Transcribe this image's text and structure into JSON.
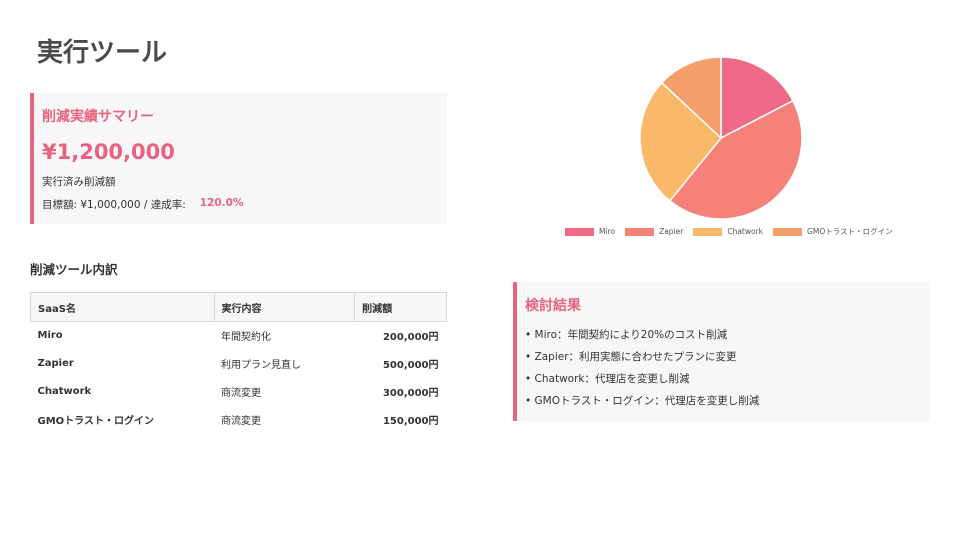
{
  "page": {
    "title": "実行ツール"
  },
  "summary": {
    "heading": "削減実績サマリー",
    "amount": "¥1,200,000",
    "sub_label": "実行済み削減額",
    "target_label": "目標額: ¥1,000,000 / 達成率:",
    "rate": "120.0%"
  },
  "breakdown": {
    "title": "削減ツール内訳",
    "headers": [
      "SaaS名",
      "実行内容",
      "削減額"
    ],
    "rows": [
      {
        "name": "Miro",
        "action": "年間契約化",
        "amount": "200,000円"
      },
      {
        "name": "Zapier",
        "action": "利用プラン見直し",
        "amount": "500,000円"
      },
      {
        "name": "Chatwork",
        "action": "商流変更",
        "amount": "300,000円"
      },
      {
        "name": "GMOトラスト・ログイン",
        "action": "商流変更",
        "amount": "150,000円"
      }
    ]
  },
  "chart_data": {
    "type": "pie",
    "categories": [
      "Miro",
      "Zapier",
      "Chatwork",
      "GMOトラスト・ログイン"
    ],
    "values": [
      200000,
      500000,
      300000,
      150000
    ],
    "colors": [
      "#ef6a86",
      "#f58178",
      "#f9b968",
      "#f49f6a"
    ],
    "legend": "bottom"
  },
  "results": {
    "heading": "検討結果",
    "items": [
      "• Miro：年間契約により20%のコスト削減",
      "• Zapier：利用実態に合わせたプランに変更",
      "• Chatwork：代理店を変更し削減",
      "• GMOトラスト・ログイン：代理店を変更し削減"
    ]
  }
}
